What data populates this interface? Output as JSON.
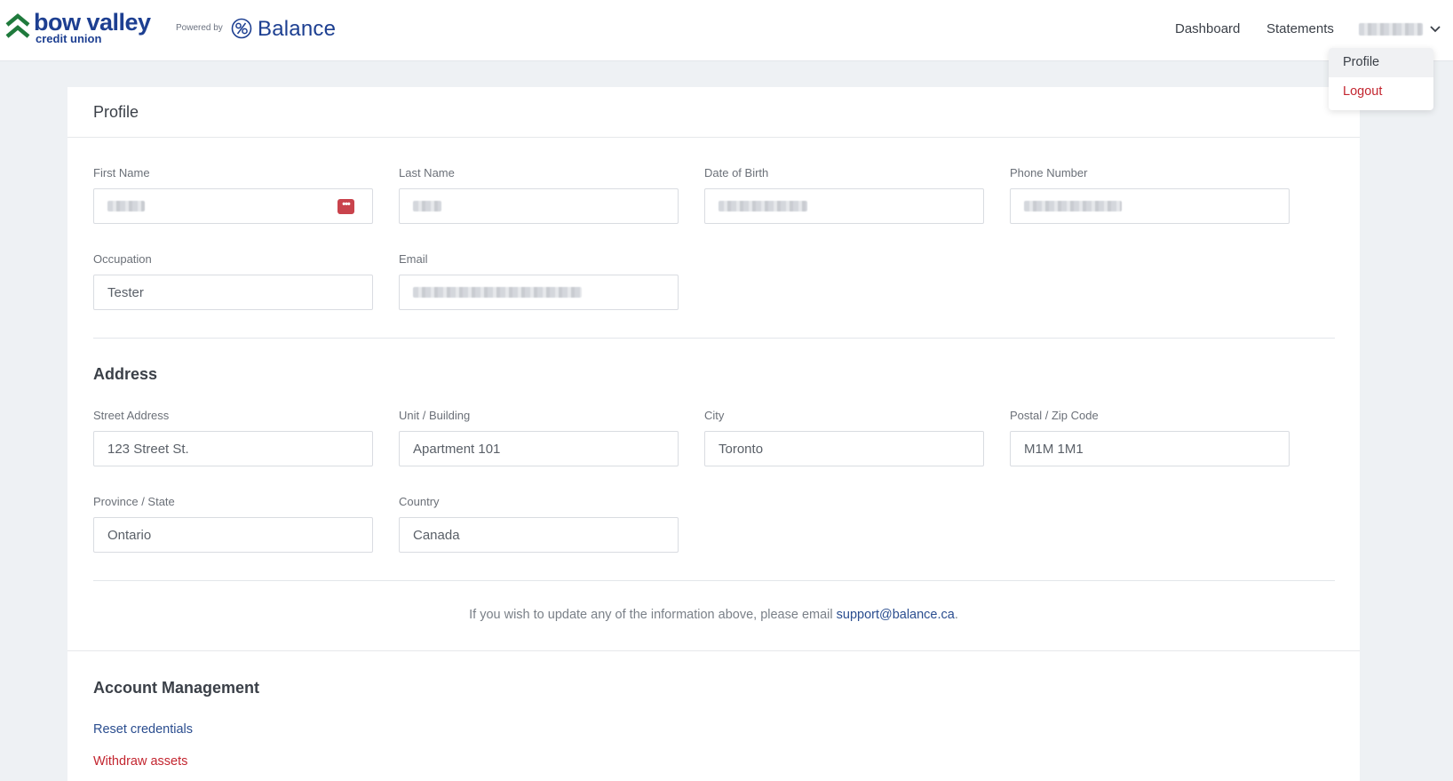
{
  "header": {
    "brand_name": "bow valley",
    "brand_sub": "credit union",
    "powered_by": "Powered by",
    "partner_name": "Balance",
    "nav": {
      "dashboard": "Dashboard",
      "statements": "Statements"
    },
    "brand_color": "#1d3f91",
    "chevron_color": "#1f7a3c"
  },
  "dropdown": {
    "items": [
      {
        "label": "Profile"
      },
      {
        "label": "Logout"
      }
    ]
  },
  "profile": {
    "title": "Profile",
    "fields": {
      "first_name": {
        "label": "First Name",
        "value": ""
      },
      "last_name": {
        "label": "Last Name",
        "value": ""
      },
      "dob": {
        "label": "Date of Birth",
        "value": ""
      },
      "phone": {
        "label": "Phone Number",
        "value": ""
      },
      "occupation": {
        "label": "Occupation",
        "value": "Tester"
      },
      "email": {
        "label": "Email",
        "value": ""
      }
    }
  },
  "address": {
    "title": "Address",
    "fields": {
      "street": {
        "label": "Street Address",
        "value": "123 Street St."
      },
      "unit": {
        "label": "Unit / Building",
        "value": "Apartment 101"
      },
      "city": {
        "label": "City",
        "value": "Toronto"
      },
      "postal": {
        "label": "Postal / Zip Code",
        "value": "M1M 1M1"
      },
      "province": {
        "label": "Province / State",
        "value": "Ontario"
      },
      "country": {
        "label": "Country",
        "value": "Canada"
      }
    }
  },
  "note": {
    "text": "If you wish to update any of the information above, please email ",
    "email": "support@balance.ca",
    "end": "."
  },
  "account_management": {
    "title": "Account Management",
    "reset": "Reset credentials",
    "withdraw": "Withdraw assets"
  },
  "colors": {
    "danger": "#c3252f",
    "link": "#2a4d8f"
  }
}
